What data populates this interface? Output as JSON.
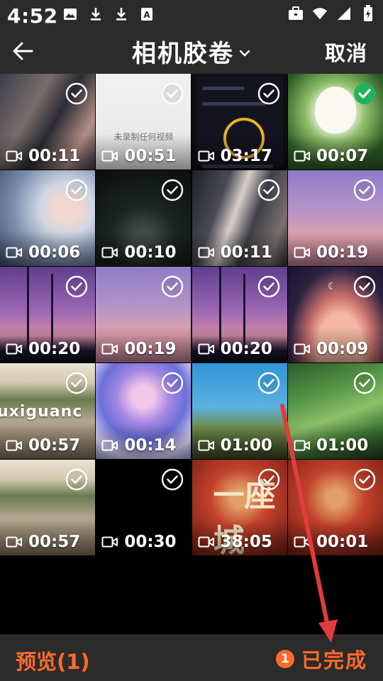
{
  "status_bar": {
    "time": "4:52",
    "icons": [
      "gallery-icon",
      "download-icon",
      "download-icon",
      "text-a-icon",
      "briefcase-icon",
      "wifi-icon",
      "signal-icon",
      "battery-charging-icon"
    ]
  },
  "header": {
    "title": "相机胶卷",
    "cancel_label": "取消"
  },
  "grid": {
    "items": [
      {
        "duration": "00:11",
        "selected": false,
        "thumb": "drama"
      },
      {
        "duration": "00:51",
        "selected": false,
        "thumb": "white",
        "text": "未录制任何视频"
      },
      {
        "duration": "03:17",
        "selected": false,
        "thumb": "app"
      },
      {
        "duration": "00:07",
        "selected": true,
        "thumb": "bunny"
      },
      {
        "duration": "00:06",
        "selected": false,
        "thumb": "anime"
      },
      {
        "duration": "00:10",
        "selected": false,
        "thumb": "night"
      },
      {
        "duration": "00:11",
        "selected": false,
        "thumb": "drama2"
      },
      {
        "duration": "00:19",
        "selected": false,
        "thumb": "sky"
      },
      {
        "duration": "00:20",
        "selected": false,
        "thumb": "dusk"
      },
      {
        "duration": "00:19",
        "selected": false,
        "thumb": "sky"
      },
      {
        "duration": "00:20",
        "selected": false,
        "thumb": "dusk"
      },
      {
        "duration": "00:09",
        "selected": false,
        "thumb": "clouds"
      },
      {
        "duration": "00:57",
        "selected": false,
        "thumb": "town",
        "text": "uxiguanc"
      },
      {
        "duration": "00:14",
        "selected": false,
        "thumb": "princess"
      },
      {
        "duration": "01:00",
        "selected": false,
        "thumb": "moto"
      },
      {
        "duration": "01:00",
        "selected": false,
        "thumb": "hills"
      },
      {
        "duration": "00:57",
        "selected": false,
        "thumb": "town"
      },
      {
        "duration": "00:30",
        "selected": false,
        "thumb": "black"
      },
      {
        "duration": "38:05",
        "selected": false,
        "thumb": "red",
        "text": "一座城"
      },
      {
        "duration": "00:01",
        "selected": false,
        "thumb": "red"
      }
    ]
  },
  "bottom_bar": {
    "preview_label": "预览(1)",
    "selected_count": "1",
    "done_label": "已完成"
  },
  "colors": {
    "accent": "#ff6a2a",
    "bar_background": "#2b2b2b",
    "selected_check": "#1fb35a",
    "annotation_arrow": "#e23b3b"
  }
}
